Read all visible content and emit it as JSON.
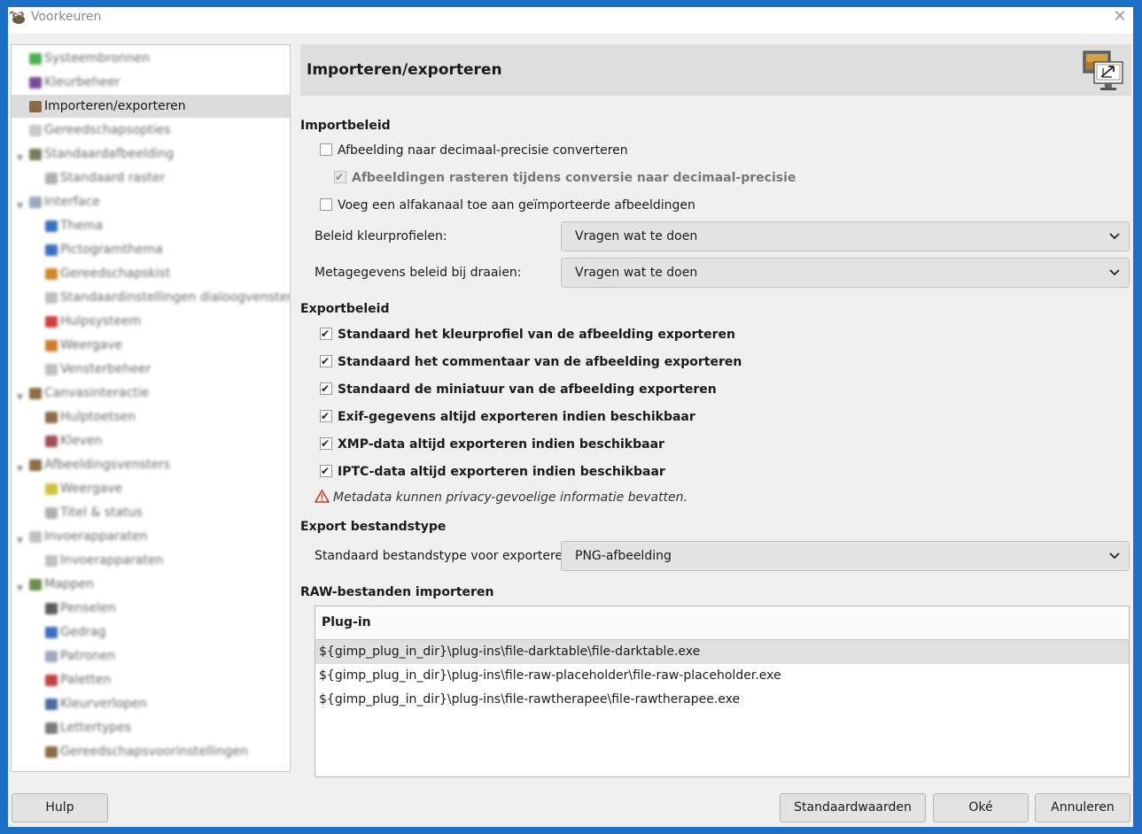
{
  "window": {
    "title": "Voorkeuren",
    "close_glyph": "✕"
  },
  "sidebar": {
    "items": [
      {
        "label": "Systeembronnen",
        "indent": 0,
        "icon_color": "#4caf50"
      },
      {
        "label": "Kleurbeheer",
        "indent": 0,
        "icon_color": "#7a4a9a"
      },
      {
        "label": "Importeren/exporteren",
        "indent": 0,
        "selected": true,
        "icon_color": "#8a6b45"
      },
      {
        "label": "Gereedschapsopties",
        "indent": 0,
        "icon_color": "#c8c8c8"
      },
      {
        "label": "Standaardafbeelding",
        "indent": 0,
        "expander": true,
        "icon_color": "#7a7a5a"
      },
      {
        "label": "Standaard raster",
        "indent": 1,
        "icon_color": "#b0b0b0"
      },
      {
        "label": "Interface",
        "indent": 0,
        "expander": true,
        "icon_color": "#9aa8c0"
      },
      {
        "label": "Thema",
        "indent": 1,
        "icon_color": "#3a6fc0"
      },
      {
        "label": "Pictogramthema",
        "indent": 1,
        "icon_color": "#3a6fc0"
      },
      {
        "label": "Gereedschapskist",
        "indent": 1,
        "icon_color": "#d08a2a"
      },
      {
        "label": "Standaardinstellingen dialoogvensters",
        "indent": 1,
        "icon_color": "#c0c0c0"
      },
      {
        "label": "Hulpsysteem",
        "indent": 1,
        "icon_color": "#d04040"
      },
      {
        "label": "Weergave",
        "indent": 1,
        "icon_color": "#d07a2a"
      },
      {
        "label": "Vensterbeheer",
        "indent": 1,
        "icon_color": "#c0c0c0"
      },
      {
        "label": "Canvasinteractie",
        "indent": 0,
        "expander": true,
        "icon_color": "#8a6b45"
      },
      {
        "label": "Hulptoetsen",
        "indent": 1,
        "icon_color": "#8a6b45"
      },
      {
        "label": "Kleven",
        "indent": 1,
        "icon_color": "#a05050"
      },
      {
        "label": "Afbeeldingsvensters",
        "indent": 0,
        "expander": true,
        "icon_color": "#8a6b45"
      },
      {
        "label": "Weergave",
        "indent": 1,
        "icon_color": "#d0c040"
      },
      {
        "label": "Titel & status",
        "indent": 1,
        "icon_color": "#b0b0b0"
      },
      {
        "label": "Invoerapparaten",
        "indent": 0,
        "expander": true,
        "icon_color": "#c0c0c0"
      },
      {
        "label": "Invoerapparaten",
        "indent": 1,
        "icon_color": "#c0c0c0"
      },
      {
        "label": "Mappen",
        "indent": 0,
        "expander": true,
        "icon_color": "#6a8a4a"
      },
      {
        "label": "Penselen",
        "indent": 1,
        "icon_color": "#5a5a5a"
      },
      {
        "label": "Gedrag",
        "indent": 1,
        "icon_color": "#3a6fc0"
      },
      {
        "label": "Patronen",
        "indent": 1,
        "icon_color": "#a0a8c0"
      },
      {
        "label": "Paletten",
        "indent": 1,
        "icon_color": "#c04040"
      },
      {
        "label": "Kleurverlopen",
        "indent": 1,
        "icon_color": "#4a6aa0"
      },
      {
        "label": "Lettertypes",
        "indent": 1,
        "icon_color": "#7a7a7a"
      },
      {
        "label": "Gereedschapsvoorinstellingen",
        "indent": 1,
        "icon_color": "#8a6b45"
      }
    ]
  },
  "main": {
    "title": "Importeren/exporteren",
    "header_icon": "import-export-monitor-icon",
    "import_policy": {
      "title": "Importbeleid",
      "convert_precision": {
        "label": "Afbeelding naar decimaal-precisie converteren",
        "checked": false
      },
      "dither": {
        "label": "Afbeeldingen rasteren tijdens conversie naar decimaal-precisie",
        "checked": true,
        "disabled": true
      },
      "alpha": {
        "label": "Voeg een alfakanaal toe aan geïmporteerde afbeeldingen",
        "checked": false
      },
      "color_profile_label": "Beleid kleurprofielen:",
      "color_profile_value": "Vragen wat te doen",
      "metadata_rotation_label": "Metagegevens beleid bij draaien:",
      "metadata_rotation_value": "Vragen wat te doen"
    },
    "export_policy": {
      "title": "Exportbeleid",
      "options": [
        {
          "label": "Standaard het kleurprofiel van de afbeelding exporteren",
          "checked": true
        },
        {
          "label": "Standaard het commentaar van de afbeelding exporteren",
          "checked": true
        },
        {
          "label": "Standaard de miniatuur van de afbeelding exporteren",
          "checked": true
        },
        {
          "label": "Exif-gegevens altijd exporteren indien beschikbaar",
          "checked": true
        },
        {
          "label": "XMP-data altijd exporteren indien beschikbaar",
          "checked": true
        },
        {
          "label": "IPTC-data altijd exporteren indien beschikbaar",
          "checked": true
        }
      ],
      "warning": "Metadata kunnen privacy-gevoelige informatie bevatten.",
      "warning_color": "#c0392b"
    },
    "export_filetype": {
      "title": "Export bestandstype",
      "label": "Standaard bestandstype voor exporteren:",
      "value": "PNG-afbeelding"
    },
    "raw": {
      "title": "RAW-bestanden importeren",
      "column": "Plug-in",
      "rows": [
        "${gimp_plug_in_dir}\\plug-ins\\file-darktable\\file-darktable.exe",
        "${gimp_plug_in_dir}\\plug-ins\\file-raw-placeholder\\file-raw-placeholder.exe",
        "${gimp_plug_in_dir}\\plug-ins\\file-rawtherapee\\file-rawtherapee.exe"
      ],
      "selected_row": 0
    }
  },
  "footer": {
    "help": "Hulp",
    "reset": "Standaardwaarden",
    "ok": "Oké",
    "cancel": "Annuleren"
  }
}
